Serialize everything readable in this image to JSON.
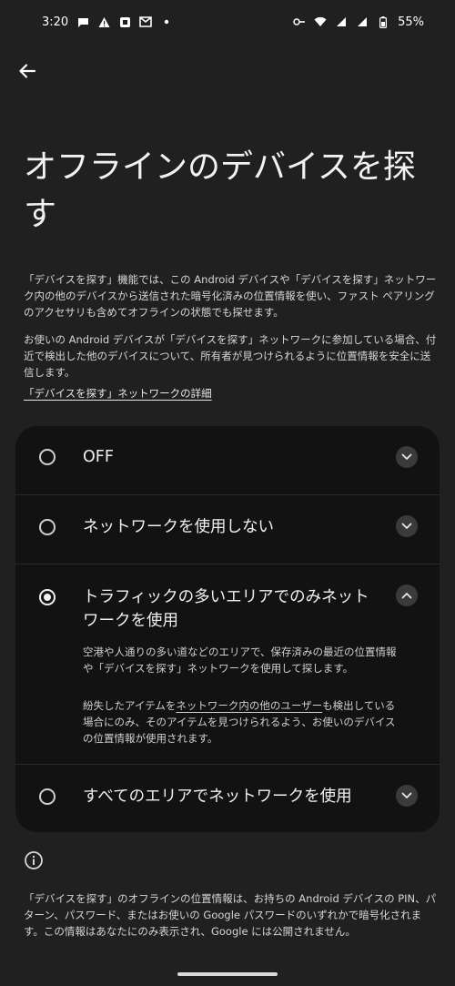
{
  "status_bar": {
    "time": "3:20",
    "battery": "55%"
  },
  "page": {
    "title": "オフラインのデバイスを探す",
    "intro_1": "「デバイスを探す」機能では、この Android デバイスや「デバイスを探す」ネットワーク内の他のデバイスから送信された暗号化済みの位置情報を使い、ファスト ペアリングのアクセサリも含めてオフラインの状態でも探せます。",
    "intro_2": "お使いの Android デバイスが「デバイスを探す」ネットワークに参加している場合、付近で検出した他のデバイスについて、所有者が見つけられるように位置情報を安全に送信します。",
    "details_link": "「デバイスを探す」ネットワークの詳細"
  },
  "options": [
    {
      "label": "OFF",
      "selected": false,
      "expanded": false
    },
    {
      "label": "ネットワークを使用しない",
      "selected": false,
      "expanded": false
    },
    {
      "label": "トラフィックの多いエリアでのみネットワークを使用",
      "selected": true,
      "expanded": true,
      "desc_1": "空港や人通りの多い道などのエリアで、保存済みの最近の位置情報や「デバイスを探す」ネットワークを使用して探します。",
      "desc_2_pre": "紛失したアイテムを",
      "desc_2_link": "ネットワーク内の他のユーザー",
      "desc_2_post": "も検出している場合にのみ、そのアイテムを見つけられるよう、お使いのデバイスの位置情報が使用されます。"
    },
    {
      "label": "すべてのエリアでネットワークを使用",
      "selected": false,
      "expanded": false
    }
  ],
  "footer": "「デバイスを探す」のオフラインの位置情報は、お持ちの Android デバイスの PIN、パターン、パスワード、またはお使いの Google パスワードのいずれかで暗号化されます。この情報はあなたにのみ表示され、Google には公開されません。",
  "colors": {
    "background": "#202020",
    "card": "#121212",
    "text": "#e6e1e5"
  },
  "icons": [
    "back-arrow-icon",
    "chevron-down-icon",
    "chevron-up-icon",
    "info-icon",
    "wifi-icon",
    "signal-icon",
    "battery-icon",
    "key-icon"
  ]
}
